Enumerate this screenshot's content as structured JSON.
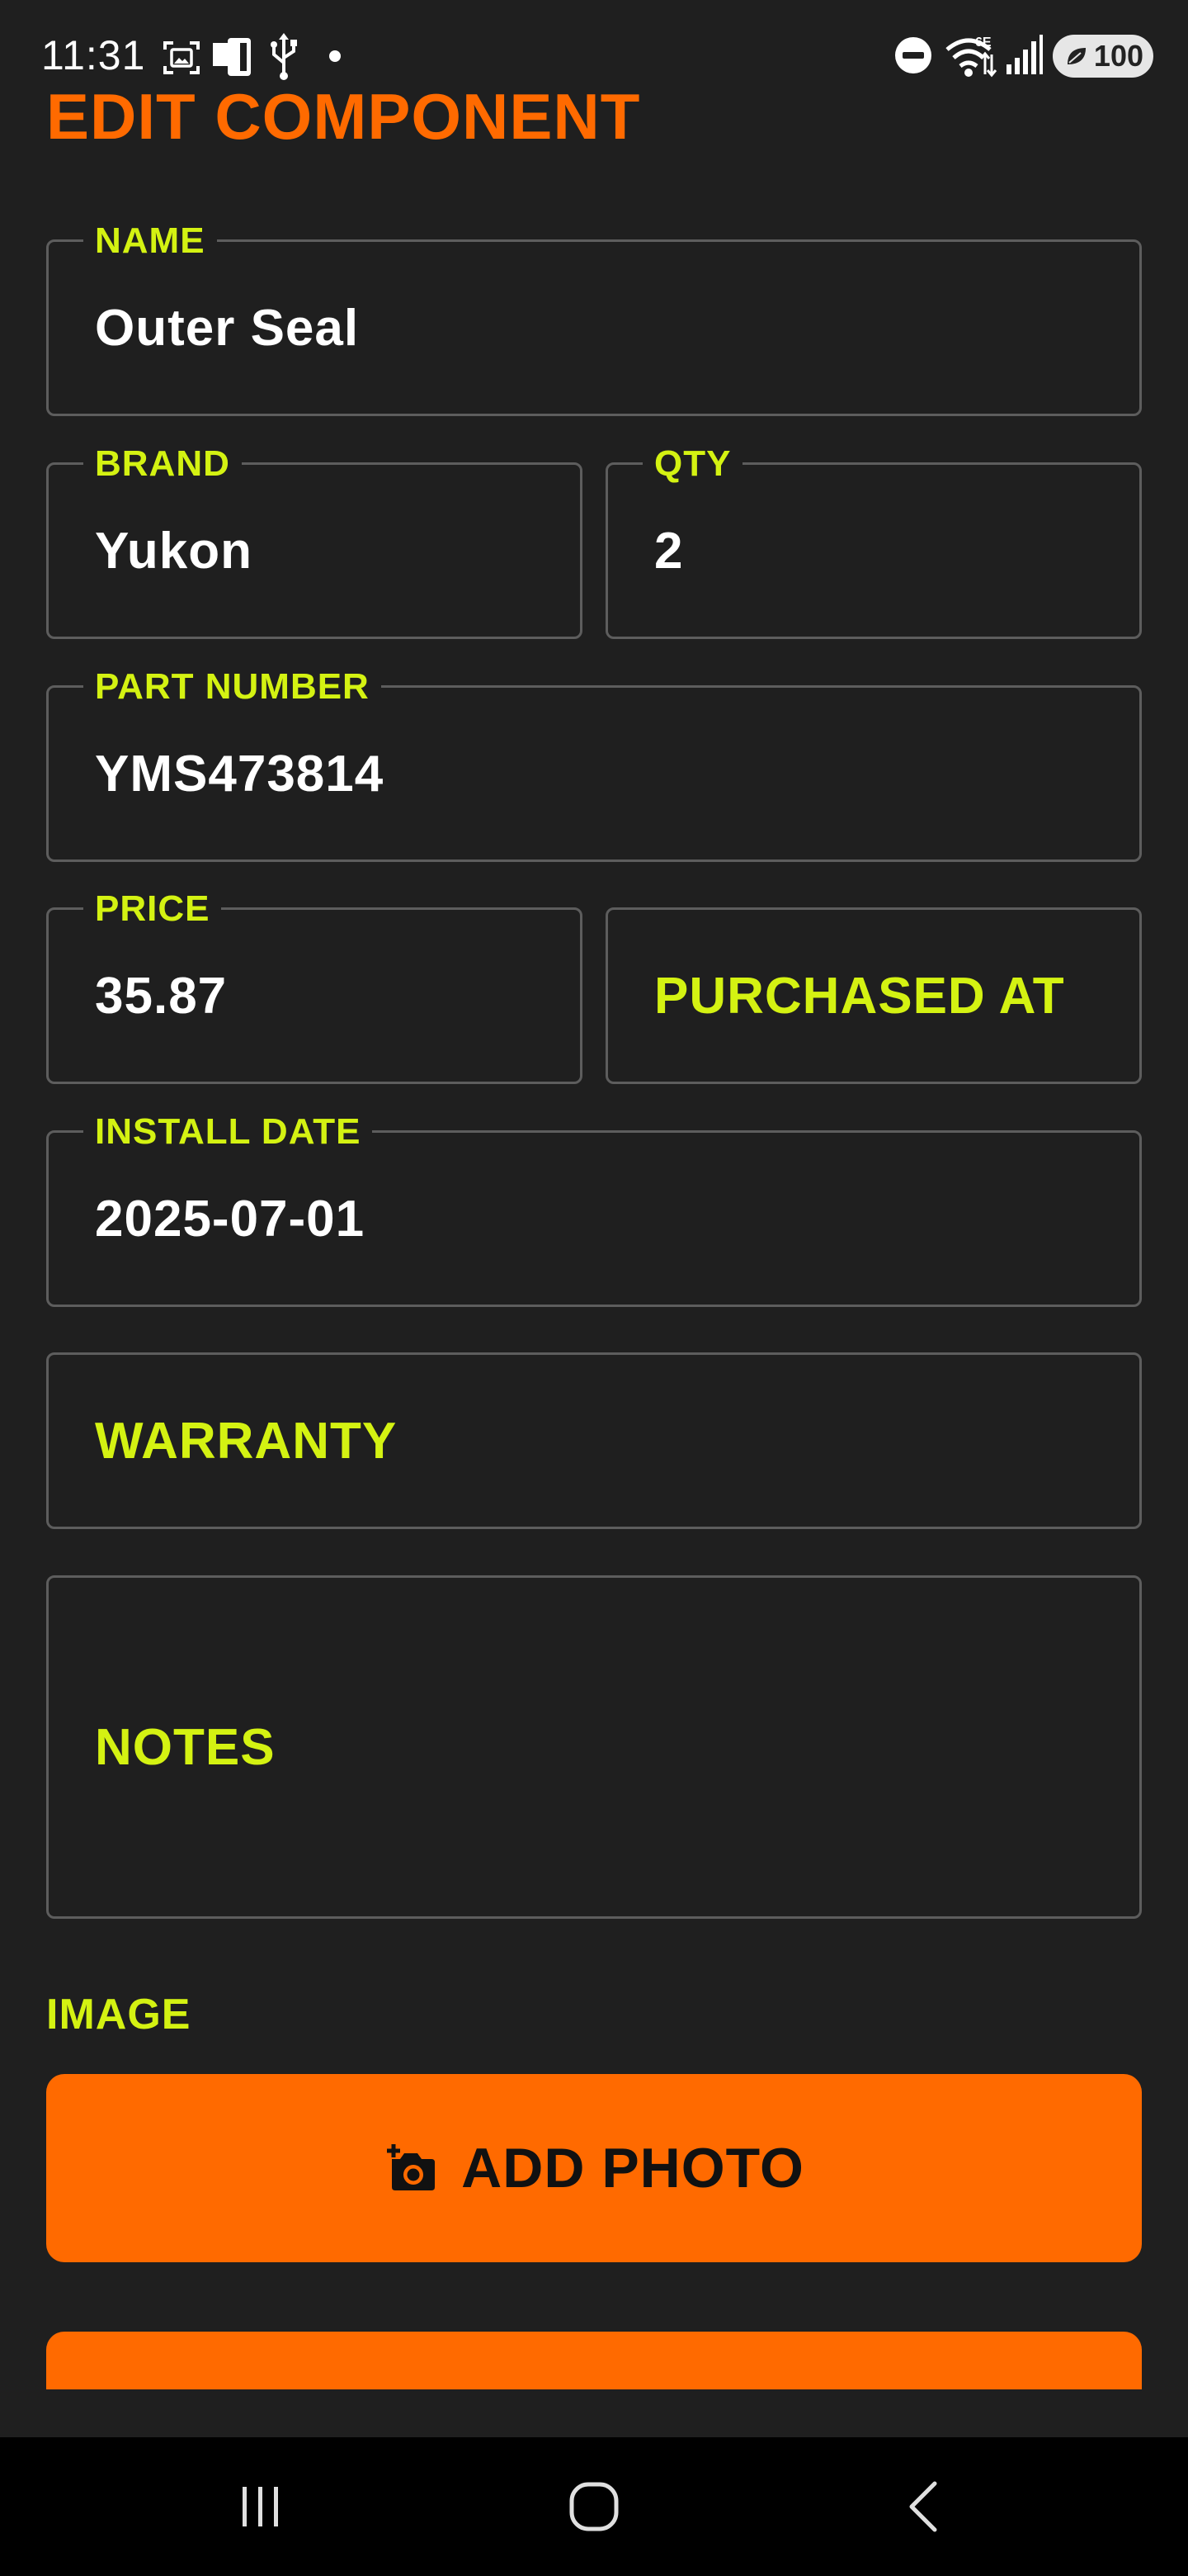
{
  "status_bar": {
    "time": "11:31",
    "battery": "100",
    "icons": [
      "screenshot-icon",
      "device-icon",
      "usb-icon",
      "dot-icon",
      "do-not-disturb-icon",
      "wifi-6e-icon",
      "signal-icon",
      "battery-icon"
    ]
  },
  "page": {
    "title": "EDIT COMPONENT"
  },
  "form": {
    "name": {
      "label": "NAME",
      "value": "Outer Seal"
    },
    "brand": {
      "label": "BRAND",
      "value": "Yukon"
    },
    "qty": {
      "label": "QTY",
      "value": "2"
    },
    "part_number": {
      "label": "PART NUMBER",
      "value": "YMS473814"
    },
    "price": {
      "label": "PRICE",
      "value": "35.87"
    },
    "purchased_at": {
      "placeholder": "PURCHASED AT"
    },
    "install_date": {
      "label": "INSTALL DATE",
      "value": "2025-07-01"
    },
    "warranty": {
      "placeholder": "WARRANTY"
    },
    "notes": {
      "placeholder": "NOTES"
    }
  },
  "image_section": {
    "label": "IMAGE",
    "add_photo_label": "ADD PHOTO",
    "add_photo_icon": "add-camera-icon"
  },
  "nav_bar": {
    "items": [
      "recent-apps-icon",
      "home-icon",
      "back-icon"
    ]
  },
  "colors": {
    "background": "#1f1f1f",
    "accent_orange": "#ff6a00",
    "label_lime": "#d4f212",
    "field_border": "#5d5d5d",
    "text_white": "#ffffff"
  }
}
